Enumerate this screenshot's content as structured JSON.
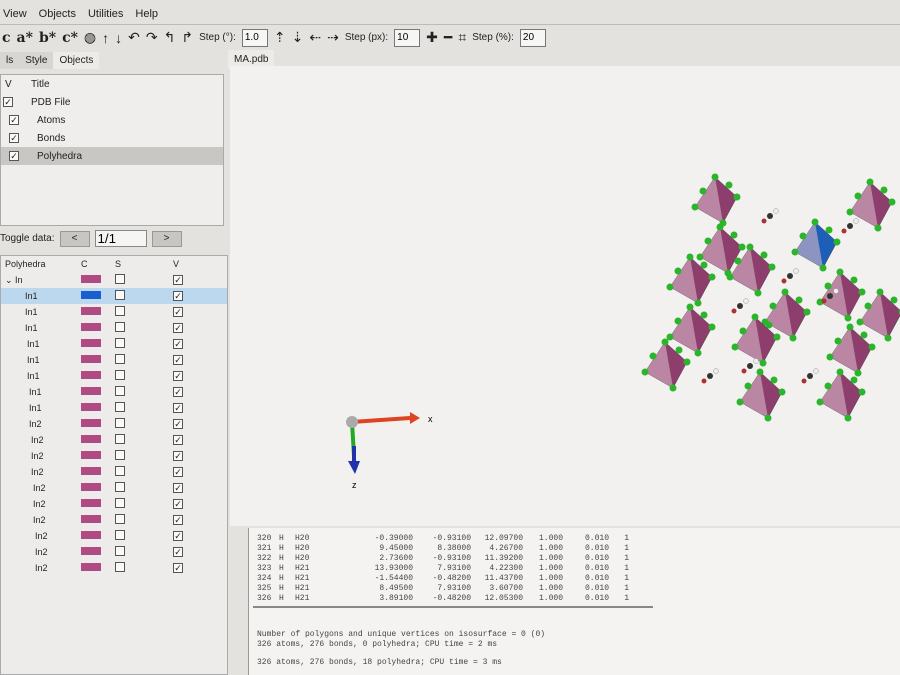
{
  "menu": [
    "View",
    "Objects",
    "Utilities",
    "Help"
  ],
  "toolbar": {
    "axes": [
      "c",
      "a*",
      "b*",
      "c*"
    ],
    "step_deg_label": "Step (°):",
    "step_deg": "1.0",
    "step_px_label": "Step (px):",
    "step_px": "10",
    "step_pct_label": "Step (%):",
    "step_pct": "20"
  },
  "tabs": [
    "ls",
    "Style",
    "Objects"
  ],
  "view_tab": "MA.pdb",
  "objects": {
    "header_v": "V",
    "header_title": "Title",
    "rows": [
      "PDB File",
      "Atoms",
      "Bonds",
      "Polyhedra"
    ]
  },
  "toggle": {
    "label": "Toggle data:",
    "prev": "<",
    "value": "1/1",
    "next": ">"
  },
  "polyhedra": {
    "headers": [
      "Polyhedra",
      "C",
      "S",
      "V"
    ],
    "group": "In",
    "items": [
      "In1",
      "In1",
      "In1",
      "In1",
      "In1",
      "In1",
      "In1",
      "In1",
      "In2",
      "In2",
      "In2",
      "In2",
      "In2",
      "In2",
      "In2",
      "In2",
      "In2",
      "In2"
    ],
    "colors": {
      "default": "#b04a85",
      "selected": "#1a5fd0"
    }
  },
  "axes_labels": {
    "x": "x",
    "z": "z"
  },
  "console": {
    "rows": [
      [
        "320",
        "H",
        "H20",
        "-0.39000",
        "-0.93100",
        "12.09700",
        "1.000",
        "0.010",
        "1"
      ],
      [
        "321",
        "H",
        "H20",
        "9.45000",
        "8.38000",
        "4.26700",
        "1.000",
        "0.010",
        "1"
      ],
      [
        "322",
        "H",
        "H20",
        "2.73600",
        "-0.93100",
        "11.39200",
        "1.000",
        "0.010",
        "1"
      ],
      [
        "323",
        "H",
        "H21",
        "13.93000",
        "7.93100",
        "4.22300",
        "1.000",
        "0.010",
        "1"
      ],
      [
        "324",
        "H",
        "H21",
        "-1.54400",
        "-0.48200",
        "11.43700",
        "1.000",
        "0.010",
        "1"
      ],
      [
        "325",
        "H",
        "H21",
        "8.49500",
        "7.93100",
        "3.60700",
        "1.000",
        "0.010",
        "1"
      ],
      [
        "326",
        "H",
        "H21",
        "3.89100",
        "-0.48200",
        "12.05300",
        "1.000",
        "0.010",
        "1"
      ]
    ],
    "messages": [
      "Number of polygons and unique vertices on isosurface = 0 (0)",
      "326 atoms, 276 bonds, 0 polyhedra; CPU time = 2 ms",
      "326 atoms, 276 bonds, 18 polyhedra; CPU time = 3 ms"
    ]
  }
}
